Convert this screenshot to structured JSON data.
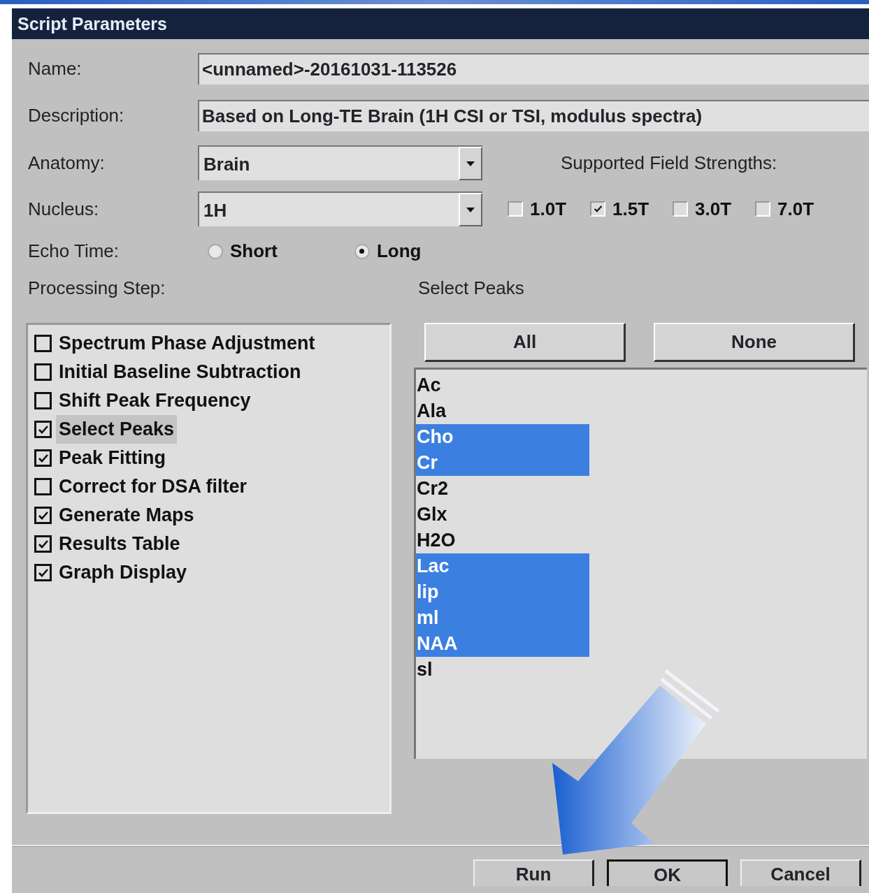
{
  "window": {
    "title": "Script Parameters"
  },
  "fields": [
    {
      "label": "Name:",
      "value": "<unnamed>-20161031-113526"
    },
    {
      "label": "Description:",
      "value": "Based on Long-TE Brain (1H CSI or TSI, modulus spectra)"
    }
  ],
  "anatomy": {
    "label": "Anatomy:",
    "value": "Brain"
  },
  "nucleus": {
    "label": "Nucleus:",
    "value": "1H"
  },
  "field_strengths": {
    "label": "Supported Field Strengths:",
    "options": [
      {
        "label": "1.0T",
        "checked": false
      },
      {
        "label": "1.5T",
        "checked": true
      },
      {
        "label": "3.0T",
        "checked": false
      },
      {
        "label": "7.0T",
        "checked": false
      }
    ]
  },
  "echo_time": {
    "label": "Echo Time:",
    "options": [
      {
        "label": "Short",
        "selected": false
      },
      {
        "label": "Long",
        "selected": true
      }
    ]
  },
  "processing": {
    "label": "Processing Step:",
    "steps": [
      {
        "label": "Spectrum Phase Adjustment",
        "checked": false,
        "selected": false
      },
      {
        "label": "Initial Baseline Subtraction",
        "checked": false,
        "selected": false
      },
      {
        "label": "Shift Peak Frequency",
        "checked": false,
        "selected": false
      },
      {
        "label": "Select Peaks",
        "checked": true,
        "selected": true
      },
      {
        "label": "Peak Fitting",
        "checked": true,
        "selected": false
      },
      {
        "label": "Correct for DSA filter",
        "checked": false,
        "selected": false
      },
      {
        "label": "Generate Maps",
        "checked": true,
        "selected": false
      },
      {
        "label": "Results Table",
        "checked": true,
        "selected": false
      },
      {
        "label": "Graph Display",
        "checked": true,
        "selected": false
      }
    ]
  },
  "peaks": {
    "label": "Select Peaks",
    "buttons": [
      "All",
      "None"
    ],
    "items": [
      {
        "label": "Ac",
        "selected": false
      },
      {
        "label": "Ala",
        "selected": false
      },
      {
        "label": "Cho",
        "selected": true
      },
      {
        "label": "Cr",
        "selected": true
      },
      {
        "label": "Cr2",
        "selected": false
      },
      {
        "label": "Glx",
        "selected": false
      },
      {
        "label": "H2O",
        "selected": false
      },
      {
        "label": "Lac",
        "selected": true
      },
      {
        "label": "lip",
        "selected": true
      },
      {
        "label": "ml",
        "selected": true
      },
      {
        "label": "NAA",
        "selected": true
      },
      {
        "label": "sl",
        "selected": false
      }
    ]
  },
  "buttons": [
    {
      "label": "Run",
      "default": false
    },
    {
      "label": "OK",
      "default": true
    },
    {
      "label": "Cancel",
      "default": false
    }
  ]
}
